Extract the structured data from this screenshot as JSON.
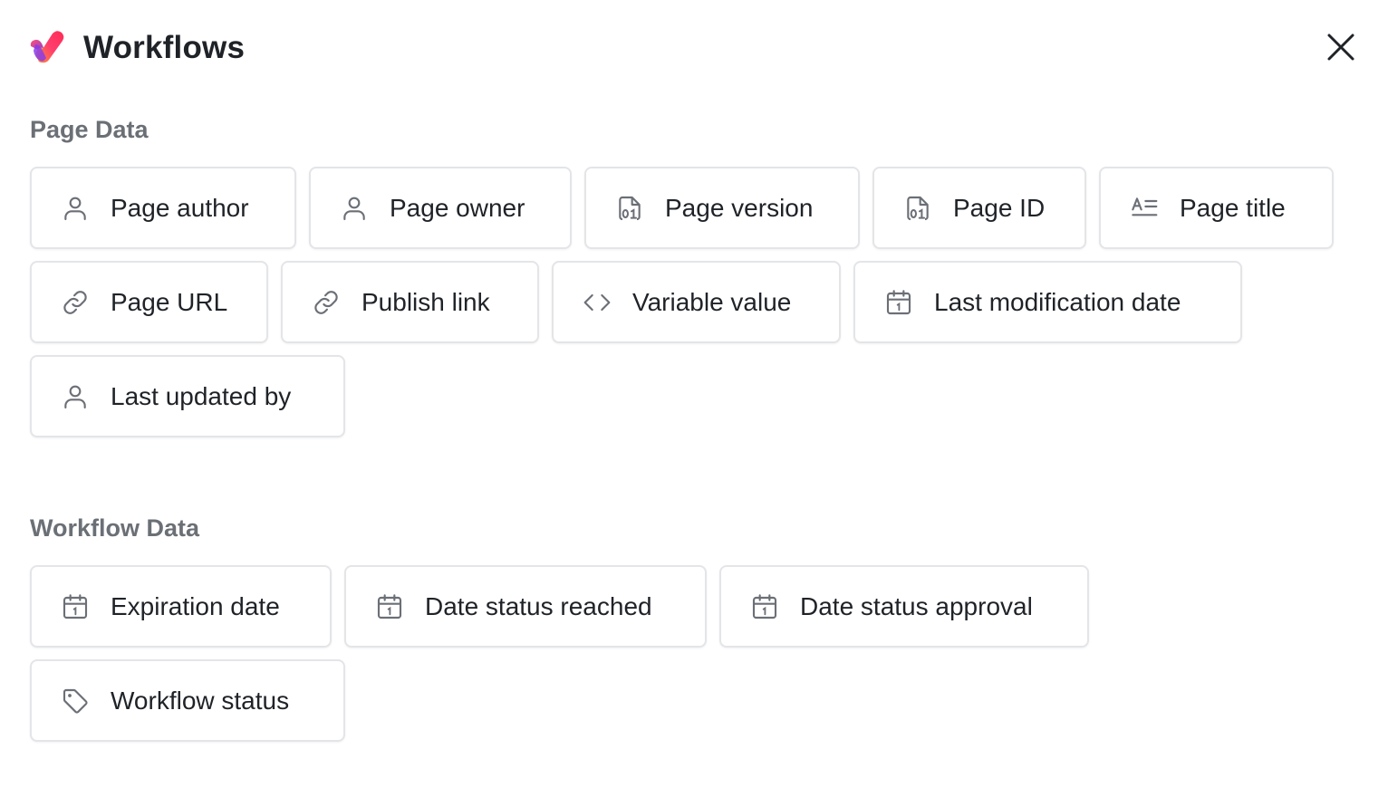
{
  "app": {
    "title": "Workflows"
  },
  "colors": {
    "text": "#1f2328",
    "section_label": "#6b6f76",
    "chip_border": "#e3e5e8",
    "icon": "#6b6f76",
    "logo_pink": "#ff3d6e",
    "logo_purple": "#7b3ff2",
    "logo_orange": "#ff8a3d"
  },
  "sections": {
    "page_data": {
      "label": "Page Data",
      "items": [
        {
          "label": "Page author",
          "icon": "user-icon"
        },
        {
          "label": "Page owner",
          "icon": "user-icon"
        },
        {
          "label": "Page version",
          "icon": "number-file-icon"
        },
        {
          "label": "Page ID",
          "icon": "number-file-icon"
        },
        {
          "label": "Page title",
          "icon": "text-title-icon"
        },
        {
          "label": "Page URL",
          "icon": "link-icon"
        },
        {
          "label": "Publish link",
          "icon": "link-icon"
        },
        {
          "label": "Variable value",
          "icon": "code-icon"
        },
        {
          "label": "Last modification date",
          "icon": "calendar-icon"
        },
        {
          "label": "Last updated by",
          "icon": "user-icon"
        }
      ]
    },
    "workflow_data": {
      "label": "Workflow Data",
      "items": [
        {
          "label": "Expiration date",
          "icon": "calendar-icon"
        },
        {
          "label": "Date status reached",
          "icon": "calendar-icon"
        },
        {
          "label": "Date status approval",
          "icon": "calendar-icon"
        },
        {
          "label": "Workflow status",
          "icon": "tag-icon"
        }
      ]
    }
  }
}
